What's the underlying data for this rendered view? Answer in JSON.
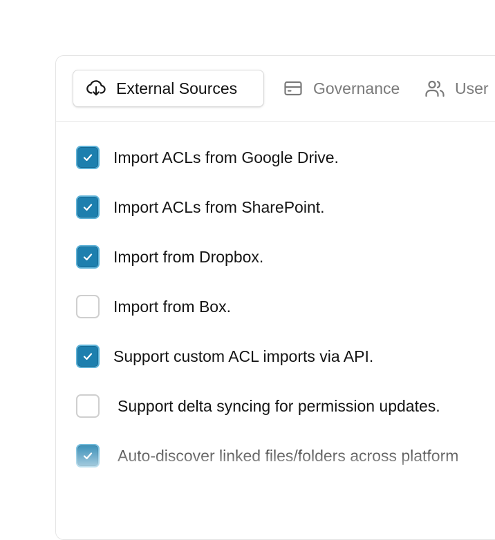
{
  "tabs": [
    {
      "label": "External Sources",
      "icon": "cloud-download-icon",
      "active": true
    },
    {
      "label": "Governance",
      "icon": "card-icon",
      "active": false
    },
    {
      "label": "User",
      "icon": "users-icon",
      "active": false
    }
  ],
  "options": [
    {
      "label": "Import ACLs from Google Drive.",
      "checked": true
    },
    {
      "label": "Import ACLs from SharePoint.",
      "checked": true
    },
    {
      "label": "Import from Dropbox.",
      "checked": true
    },
    {
      "label": "Import from Box.",
      "checked": false
    },
    {
      "label": "Support custom ACL imports via API.",
      "checked": true
    },
    {
      "label": "Support delta syncing for permission updates.",
      "checked": false
    },
    {
      "label": "Auto-discover linked files/folders across platform",
      "checked": true
    }
  ],
  "colors": {
    "checked_fill": "#1d7fae",
    "checked_border": "#5fb3d8",
    "unchecked_border": "#cfcfcf",
    "active_tab_text": "#111111",
    "inactive_tab_text": "#7a7a7a"
  }
}
